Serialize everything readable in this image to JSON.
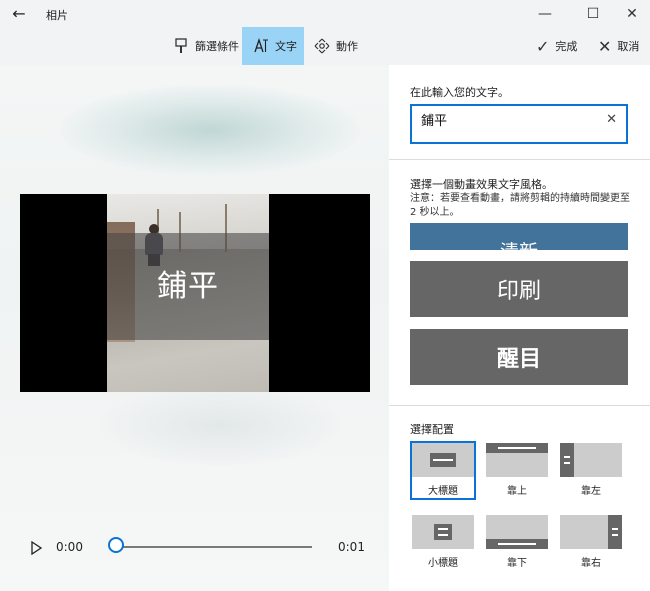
{
  "window": {
    "title": "相片",
    "controls": {
      "minimize": "—",
      "maximize": "☐",
      "close": "✕"
    }
  },
  "toolbar": {
    "filter_label": "篩選條件",
    "text_label": "文字",
    "motion_label": "動作",
    "done_label": "完成",
    "cancel_label": "取消"
  },
  "video": {
    "overlay_text": "鋪平",
    "current_time": "0:00",
    "total_time": "0:01",
    "progress": 0
  },
  "panel": {
    "input_prompt": "在此輸入您的文字。",
    "input_value": "鋪平",
    "style_heading": "選擇一個動畫效果文字風格。",
    "style_note": "注意：若要查看動畫，請將剪輯的持續時間變更至 2 秒以上。",
    "styles": [
      "清新",
      "印刷",
      "醒目"
    ],
    "layout_heading": "選擇配置",
    "layouts": [
      "大標題",
      "靠上",
      "靠左",
      "小標題",
      "靠下",
      "靠右"
    ],
    "selected_layout": "大標題"
  },
  "colors": {
    "accent": "#0a74d6",
    "active_tab": "#99d3f6",
    "style_blue": "#41739b",
    "style_gray": "#666666",
    "layout_tile": "#cccccc"
  }
}
